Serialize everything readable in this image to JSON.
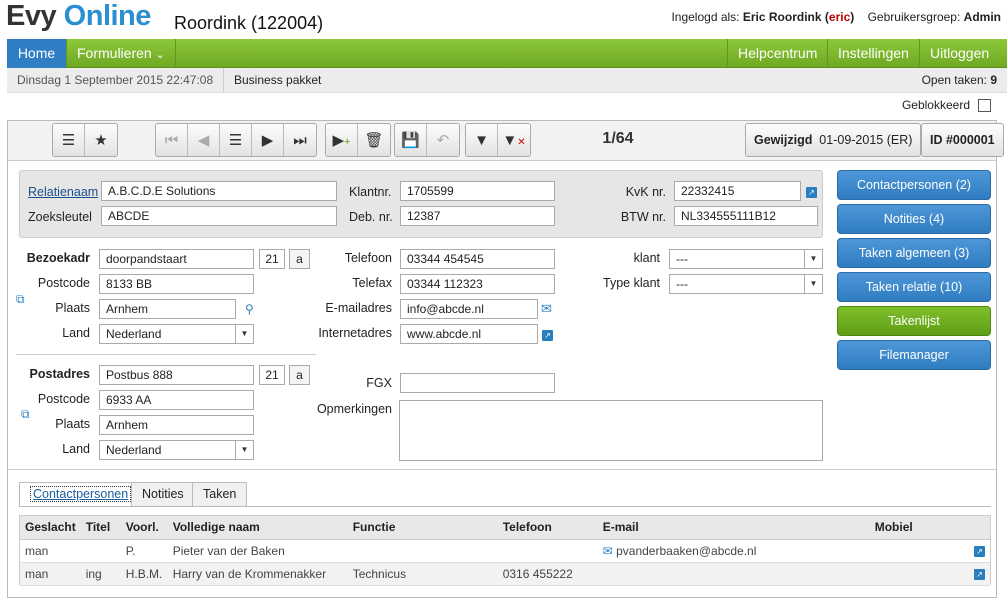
{
  "header": {
    "logo_part1": "Evy",
    "logo_part2": "Online",
    "company": "Roordink (122004)",
    "login_label": "Ingelogd als:",
    "login_name": "Eric Roordink",
    "login_user": "eric",
    "group_label": "Gebruikersgroep:",
    "group_value": "Admin"
  },
  "nav": {
    "home": "Home",
    "forms": "Formulieren",
    "help": "Helpcentrum",
    "settings": "Instellingen",
    "logout": "Uitloggen"
  },
  "subbar": {
    "datetime": "Dinsdag 1 September 2015 22:47:08",
    "package": "Business pakket",
    "open_tasks_label": "Open taken:",
    "open_tasks_value": "9"
  },
  "blocked_label": "Geblokkeerd",
  "toolbar": {
    "record_counter": "1/64",
    "modified_label": "Gewijzigd",
    "modified_value": "01-09-2015 (ER)",
    "id_label": "ID #000001"
  },
  "relation": {
    "name_label": "Relatienaam",
    "name_value": "A.B.C.D.E Solutions",
    "key_label": "Zoeksleutel",
    "key_value": "ABCDE",
    "client_nr_label": "Klantnr.",
    "client_nr_value": "1705599",
    "deb_nr_label": "Deb. nr.",
    "deb_nr_value": "12387",
    "kvk_label": "KvK nr.",
    "kvk_value": "22332415",
    "btw_label": "BTW nr.",
    "btw_value": "NL334555111B12"
  },
  "visit": {
    "address_label": "Bezoekadr",
    "street": "doorpandstaart",
    "number": "21",
    "suffix": "a",
    "zip_label": "Postcode",
    "zip": "8133 BB",
    "city_label": "Plaats",
    "city": "Arnhem",
    "country_label": "Land",
    "country": "Nederland"
  },
  "postal": {
    "address_label": "Postadres",
    "street": "Postbus 888",
    "number": "21",
    "suffix": "a",
    "zip_label": "Postcode",
    "zip": "6933 AA",
    "city_label": "Plaats",
    "city": "Arnhem",
    "country_label": "Land",
    "country": "Nederland"
  },
  "contact": {
    "phone_label": "Telefoon",
    "phone": "03344 454545",
    "fax_label": "Telefax",
    "fax": "03344 112323",
    "email_label": "E-mailadres",
    "email": "info@abcde.nl",
    "web_label": "Internetadres",
    "web": "www.abcde.nl",
    "fgx_label": "FGX",
    "fgx": "",
    "remarks_label": "Opmerkingen",
    "remarks": ""
  },
  "classification": {
    "client_label": "klant",
    "client_value": "---",
    "type_label": "Type klant",
    "type_value": "---"
  },
  "side_buttons": [
    "Contactpersonen (2)",
    "Notities (4)",
    "Taken algemeen (3)",
    "Taken relatie (10)",
    "Takenlijst",
    "Filemanager"
  ],
  "tabs": [
    "Contactpersonen",
    "Notities",
    "Taken"
  ],
  "table": {
    "headers": [
      "Geslacht",
      "Titel",
      "Voorl.",
      "Volledige naam",
      "Functie",
      "Telefoon",
      "E-mail",
      "Mobiel"
    ],
    "rows": [
      [
        "man",
        "",
        "P.",
        "Pieter van der Baken",
        "",
        "",
        "pvanderbaaken@abcde.nl",
        ""
      ],
      [
        "man",
        "ing",
        "H.B.M.",
        "Harry van de Krommenakker",
        "Technicus",
        "0316 455222",
        "",
        ""
      ]
    ]
  }
}
